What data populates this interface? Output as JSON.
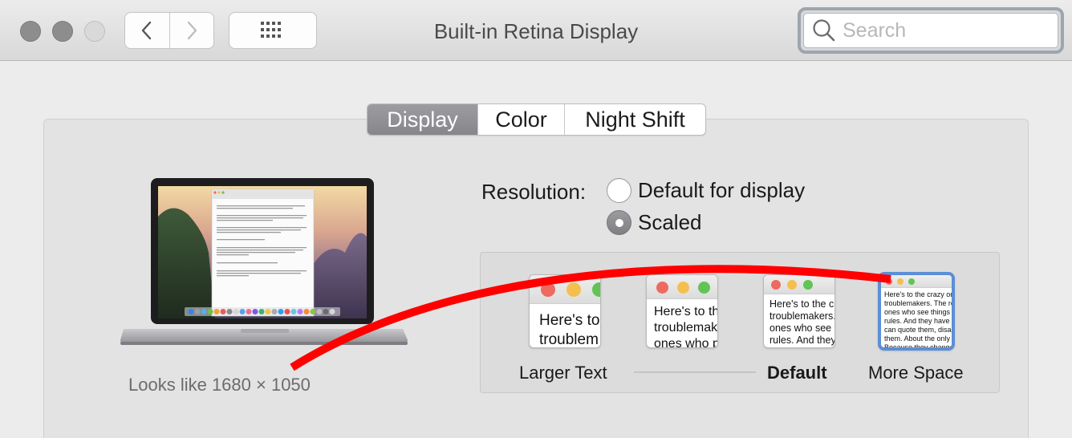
{
  "window": {
    "title": "Built-in Retina Display",
    "search_placeholder": "Search",
    "search_value": ""
  },
  "tabs": [
    {
      "label": "Display",
      "selected": true
    },
    {
      "label": "Color",
      "selected": false
    },
    {
      "label": "Night Shift",
      "selected": false
    }
  ],
  "display": {
    "looks_like": "Looks like 1680 × 1050",
    "laptop_brand": "MacBook Pro",
    "resolution_label": "Resolution:",
    "options": [
      {
        "label": "Default for display",
        "selected": false
      },
      {
        "label": "Scaled",
        "selected": true
      }
    ],
    "scaled": [
      {
        "label": "Larger Text",
        "preview": [
          "Here's to",
          "troublem"
        ],
        "selected": false
      },
      {
        "label": "",
        "preview": [
          "Here's to th",
          "troublemak",
          "ones who p"
        ],
        "selected": false
      },
      {
        "label": "Default",
        "preview": [
          "Here's to the cr",
          "troublemakers.",
          "ones who see t",
          "rules. And they"
        ],
        "selected": false
      },
      {
        "label": "More Space",
        "preview": [
          "Here's to the crazy one",
          "troublemakers. The rou",
          "ones who see things dif",
          "rules. And they have no",
          "can quote them, disagre",
          "them. About the only th",
          "Because they change t"
        ],
        "selected": true
      }
    ]
  },
  "laptop_screen_doc": [
    "Here's to the crazy ones. The misfits. The rebels. The troublemakers.",
    "The ones who see things differently. They're not fond of rules.",
    "But the only thing you can't do is ignore them.",
    "Maybe they have to be crazy.",
    "How else can you stare at an empty canvas and see a work of art?",
    "We make tools for these kinds of people.",
    "While some see them as the crazy ones, we see genius."
  ],
  "colors": {
    "accent_selected": "#5b8fd6",
    "annotation_red": "#ff0000",
    "traffic_red": "#ed6a5e",
    "traffic_yellow": "#f5bf4f",
    "traffic_green": "#61c454"
  }
}
